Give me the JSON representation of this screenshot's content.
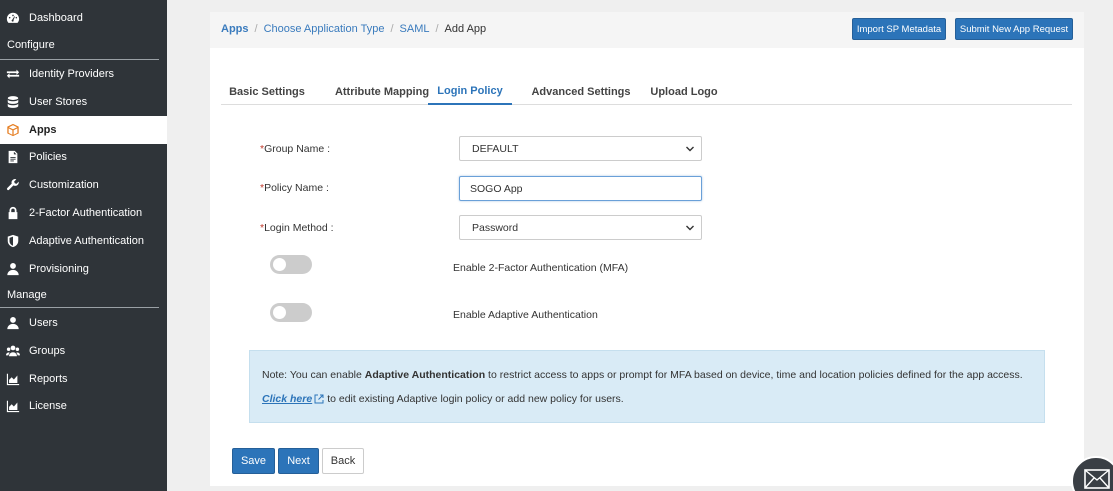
{
  "sidebar": {
    "items": [
      {
        "label": "Dashboard",
        "icon": "dashboard-icon"
      },
      {
        "label": "Identity Providers",
        "icon": "exchange-icon"
      },
      {
        "label": "User Stores",
        "icon": "database-icon"
      },
      {
        "label": "Apps",
        "icon": "cube-icon"
      },
      {
        "label": "Policies",
        "icon": "document-icon"
      },
      {
        "label": "Customization",
        "icon": "wrench-icon"
      },
      {
        "label": "2-Factor Authentication",
        "icon": "lock-icon"
      },
      {
        "label": "Adaptive Authentication",
        "icon": "shield-icon"
      },
      {
        "label": "Provisioning",
        "icon": "user-icon"
      },
      {
        "label": "Users",
        "icon": "user-icon"
      },
      {
        "label": "Groups",
        "icon": "group-icon"
      },
      {
        "label": "Reports",
        "icon": "area-chart-icon"
      },
      {
        "label": "License",
        "icon": "area-chart-icon"
      }
    ],
    "sections": {
      "configure": "Configure",
      "manage": "Manage"
    },
    "active": "Apps"
  },
  "breadcrumb": [
    "Apps",
    "Choose Application Type",
    "SAML",
    "Add App"
  ],
  "header_buttons": {
    "import": "Import SP Metadata",
    "submit": "Submit New App Request"
  },
  "tabs": [
    "Basic Settings",
    "Attribute Mapping",
    "Login Policy",
    "Advanced Settings",
    "Upload Logo"
  ],
  "active_tab": "Login Policy",
  "form": {
    "group_name": {
      "label": "Group Name :",
      "value": "DEFAULT"
    },
    "policy_name": {
      "label": "Policy Name :",
      "value": "SOGO App"
    },
    "login_method": {
      "label": "Login Method :",
      "value": "Password"
    },
    "required_marker": "*",
    "toggles": [
      {
        "label": "Enable 2-Factor Authentication (MFA)",
        "on": false
      },
      {
        "label": "Enable Adaptive Authentication",
        "on": false
      }
    ]
  },
  "note": {
    "prefix": "Note: You can enable ",
    "bold": "Adaptive Authentication",
    "suffix": " to restrict access to apps or prompt for MFA based on device, time and location policies defined for the app access.",
    "link": "Click here",
    "link_suffix": "to edit existing Adaptive login policy or add new policy for users."
  },
  "buttons": {
    "save": "Save",
    "next": "Next",
    "back": "Back"
  },
  "colors": {
    "sidebar": "#2f3439",
    "primary": "#2c74b9",
    "note_bg": "#d9ebf6"
  }
}
